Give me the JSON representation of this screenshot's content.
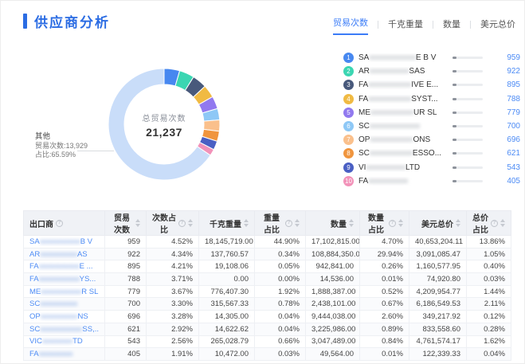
{
  "page": {
    "title": "供应商分析"
  },
  "tabs": [
    {
      "id": "trade-count",
      "label": "贸易次数",
      "active": true
    },
    {
      "id": "kg-weight",
      "label": "千克重量",
      "active": false
    },
    {
      "id": "quantity",
      "label": "数量",
      "active": false
    },
    {
      "id": "usd-total",
      "label": "美元总价",
      "active": false
    }
  ],
  "donut": {
    "center_label": "总贸易次数",
    "center_value": "21,237",
    "others_callout": {
      "title": "其他",
      "line1": "贸易次数:13,929",
      "line2": "占比:65.59%"
    },
    "segments": [
      {
        "name": "SA…E B V",
        "value": 959,
        "color": "#4788f0"
      },
      {
        "name": "AR…SAS",
        "value": 922,
        "color": "#3bd6b2"
      },
      {
        "name": "FA…IVE E…",
        "value": 895,
        "color": "#48597b"
      },
      {
        "name": "FA…SYST…",
        "value": 788,
        "color": "#f0ba43"
      },
      {
        "name": "ME…UR SL",
        "value": 779,
        "color": "#9179ef"
      },
      {
        "name": "SC…",
        "value": 700,
        "color": "#8ec8f6"
      },
      {
        "name": "OP…ONS",
        "value": 696,
        "color": "#fac08c"
      },
      {
        "name": "SC…ESSO…",
        "value": 621,
        "color": "#f0953e"
      },
      {
        "name": "VI…LTD",
        "value": 543,
        "color": "#4a5fc3"
      },
      {
        "name": "FA…",
        "value": 405,
        "color": "#f292b9"
      },
      {
        "name": "其他",
        "value": 13929,
        "color": "#c9ddf9"
      }
    ]
  },
  "chart_data": {
    "type": "pie",
    "title": "总贸易次数 21,237",
    "total": 21237,
    "legend_position": "right",
    "series": [
      {
        "name": "SA…E B V",
        "value": 959,
        "pct": "4.52%"
      },
      {
        "name": "AR…SAS",
        "value": 922,
        "pct": "4.34%"
      },
      {
        "name": "FA…IVE E…",
        "value": 895,
        "pct": "4.21%"
      },
      {
        "name": "FA…SYST…",
        "value": 788,
        "pct": "3.71%"
      },
      {
        "name": "ME…UR SL",
        "value": 779,
        "pct": "3.67%"
      },
      {
        "name": "SC…",
        "value": 700,
        "pct": "3.30%"
      },
      {
        "name": "OP…ONS",
        "value": 696,
        "pct": "3.28%"
      },
      {
        "name": "SC…ESSO…",
        "value": 621,
        "pct": "2.92%"
      },
      {
        "name": "VI…LTD",
        "value": 543,
        "pct": "2.56%"
      },
      {
        "name": "FA…",
        "value": 405,
        "pct": "1.91%"
      },
      {
        "name": "其他",
        "value": 13929,
        "pct": "65.59%"
      }
    ]
  },
  "legend": {
    "items": [
      {
        "rank": "1",
        "color": "#4788f0",
        "prefix": "SA",
        "blur": "xxxxxxxxxxxxx",
        "suffix": " E B V",
        "value": "959"
      },
      {
        "rank": "2",
        "color": "#3bd6b2",
        "prefix": "AR",
        "blur": "xxxxxxxxxxx",
        "suffix": " SAS",
        "value": "922"
      },
      {
        "rank": "3",
        "color": "#48597b",
        "prefix": "FA",
        "blur": "xxxxxxxxxxxx",
        "suffix": "IVE E...",
        "value": "895"
      },
      {
        "rank": "4",
        "color": "#f0ba43",
        "prefix": "FA",
        "blur": "xxxxxxxxxxxx",
        "suffix": " SYST...",
        "value": "788"
      },
      {
        "rank": "5",
        "color": "#9179ef",
        "prefix": "ME",
        "blur": "xxxxxxxxxxxx",
        "suffix": "UR SL",
        "value": "779"
      },
      {
        "rank": "6",
        "color": "#8ec8f6",
        "prefix": "SC",
        "blur": "xxxxxxxxxxxxxx",
        "suffix": "",
        "value": "700"
      },
      {
        "rank": "7",
        "color": "#fac08c",
        "prefix": "OP",
        "blur": "xxxxxxxxxxxx",
        "suffix": "ONS",
        "value": "696"
      },
      {
        "rank": "8",
        "color": "#f0953e",
        "prefix": "SC",
        "blur": "xxxxxxxxxxxx",
        "suffix": " ESSO...",
        "value": "621"
      },
      {
        "rank": "9",
        "color": "#4a5fc3",
        "prefix": "VI",
        "blur": "xxxxxxxxxxx",
        "suffix": " LTD",
        "value": "543"
      },
      {
        "rank": "10",
        "color": "#f292b9",
        "prefix": "FA",
        "blur": "xxxxxxxxxxx",
        "suffix": "",
        "value": "405"
      }
    ]
  },
  "table": {
    "columns": [
      {
        "id": "exporter",
        "label": "出口商",
        "has_info": true,
        "has_sort": false,
        "align": "left"
      },
      {
        "id": "trade-count",
        "label": "贸易次数",
        "has_info": false,
        "has_sort": true,
        "align": "right"
      },
      {
        "id": "count-pct",
        "label": "次数占比",
        "has_info": true,
        "has_sort": true,
        "align": "right"
      },
      {
        "id": "kg-weight",
        "label": "千克重量",
        "has_info": false,
        "has_sort": true,
        "align": "right"
      },
      {
        "id": "weight-pct",
        "label": "重量占比",
        "has_info": true,
        "has_sort": true,
        "align": "right"
      },
      {
        "id": "quantity",
        "label": "数量",
        "has_info": false,
        "has_sort": true,
        "align": "right"
      },
      {
        "id": "quantity-pct",
        "label": "数量占比",
        "has_info": true,
        "has_sort": true,
        "align": "right"
      },
      {
        "id": "usd-total",
        "label": "美元总价",
        "has_info": false,
        "has_sort": true,
        "align": "right"
      },
      {
        "id": "price-pct",
        "label": "总价占比",
        "has_info": true,
        "has_sort": true,
        "align": "right"
      }
    ],
    "rows": [
      {
        "exporter": {
          "prefix": "SA",
          "blur": "xxxxxxxxxxxx",
          "suffix": " B V"
        },
        "cells": [
          "959",
          "4.52%",
          "18,145,719.00",
          "44.90%",
          "17,102,815.00",
          "4.70%",
          "40,653,204.11",
          "13.86%"
        ]
      },
      {
        "exporter": {
          "prefix": "AR",
          "blur": "xxxxxxxxxxx",
          "suffix": " AS"
        },
        "cells": [
          "922",
          "4.34%",
          "137,760.57",
          "0.34%",
          "108,884,350.00",
          "29.94%",
          "3,091,085.47",
          "1.05%"
        ]
      },
      {
        "exporter": {
          "prefix": "FA",
          "blur": "xxxxxxxxxxxx",
          "suffix": " E ..."
        },
        "cells": [
          "895",
          "4.21%",
          "19,108.06",
          "0.05%",
          "942,841.00",
          "0.26%",
          "1,160,577.95",
          "0.40%"
        ]
      },
      {
        "exporter": {
          "prefix": "FA",
          "blur": "xxxxxxxxxxxx",
          "suffix": " YS..."
        },
        "cells": [
          "788",
          "3.71%",
          "0.00",
          "0.00%",
          "14,536.00",
          "0.01%",
          "74,920.80",
          "0.03%"
        ]
      },
      {
        "exporter": {
          "prefix": "ME",
          "blur": "xxxxxxxxxxxx",
          "suffix": " R SL"
        },
        "cells": [
          "779",
          "3.67%",
          "776,407.30",
          "1.92%",
          "1,888,387.00",
          "0.52%",
          "4,209,954.77",
          "1.44%"
        ]
      },
      {
        "exporter": {
          "prefix": "SC",
          "blur": "xxxxxxxxxxx",
          "suffix": ""
        },
        "cells": [
          "700",
          "3.30%",
          "315,567.33",
          "0.78%",
          "2,438,101.00",
          "0.67%",
          "6,186,549.53",
          "2.11%"
        ]
      },
      {
        "exporter": {
          "prefix": "OP",
          "blur": "xxxxxxxxxxx",
          "suffix": " NS"
        },
        "cells": [
          "696",
          "3.28%",
          "14,305.00",
          "0.04%",
          "9,444,038.00",
          "2.60%",
          "349,217.92",
          "0.12%"
        ]
      },
      {
        "exporter": {
          "prefix": "SC",
          "blur": "xxxxxxxxxxxxx",
          "suffix": " SS,.."
        },
        "cells": [
          "621",
          "2.92%",
          "14,622.62",
          "0.04%",
          "3,225,986.00",
          "0.89%",
          "833,558.60",
          "0.28%"
        ]
      },
      {
        "exporter": {
          "prefix": "VIC",
          "blur": "xxxxxxxxx",
          "suffix": " TD"
        },
        "cells": [
          "543",
          "2.56%",
          "265,028.79",
          "0.66%",
          "3,047,489.00",
          "0.84%",
          "4,761,574.17",
          "1.62%"
        ]
      },
      {
        "exporter": {
          "prefix": "FA",
          "blur": "xxxxxxxxxx",
          "suffix": ""
        },
        "cells": [
          "405",
          "1.91%",
          "10,472.00",
          "0.03%",
          "49,564.00",
          "0.01%",
          "122,339.33",
          "0.04%"
        ]
      }
    ]
  }
}
